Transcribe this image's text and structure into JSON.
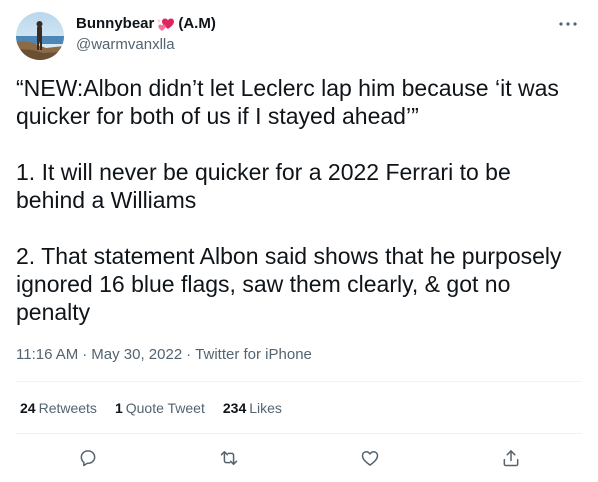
{
  "user": {
    "display_name": "Bunnybear",
    "name_suffix": "(A.M)",
    "name_emoji": "sparkling-two-hearts-emoji",
    "handle": "@warmvanxlla"
  },
  "tweet": {
    "text": "“NEW:Albon didn’t let Leclerc lap him because ‘it was quicker for both of us if I stayed ahead’”\n\n1. It will never be quicker for a 2022 Ferrari to be behind a Williams\n\n2. That statement Albon said shows that he purposely ignored 16 blue flags, saw them clearly, & got no penalty",
    "time": "11:16 AM",
    "separator": "·",
    "date": "May 30, 2022",
    "source": "Twitter for iPhone"
  },
  "stats": {
    "retweets_count": "24",
    "retweets_label": "Retweets",
    "quotes_count": "1",
    "quotes_label": "Quote Tweet",
    "likes_count": "234",
    "likes_label": "Likes"
  },
  "actions": [
    "reply-icon",
    "retweet-icon",
    "like-icon",
    "share-icon"
  ],
  "colors": {
    "text": "#0f1419",
    "secondary": "#536471",
    "divider": "#eff3f4",
    "heart_emoji": "#e0245e"
  }
}
